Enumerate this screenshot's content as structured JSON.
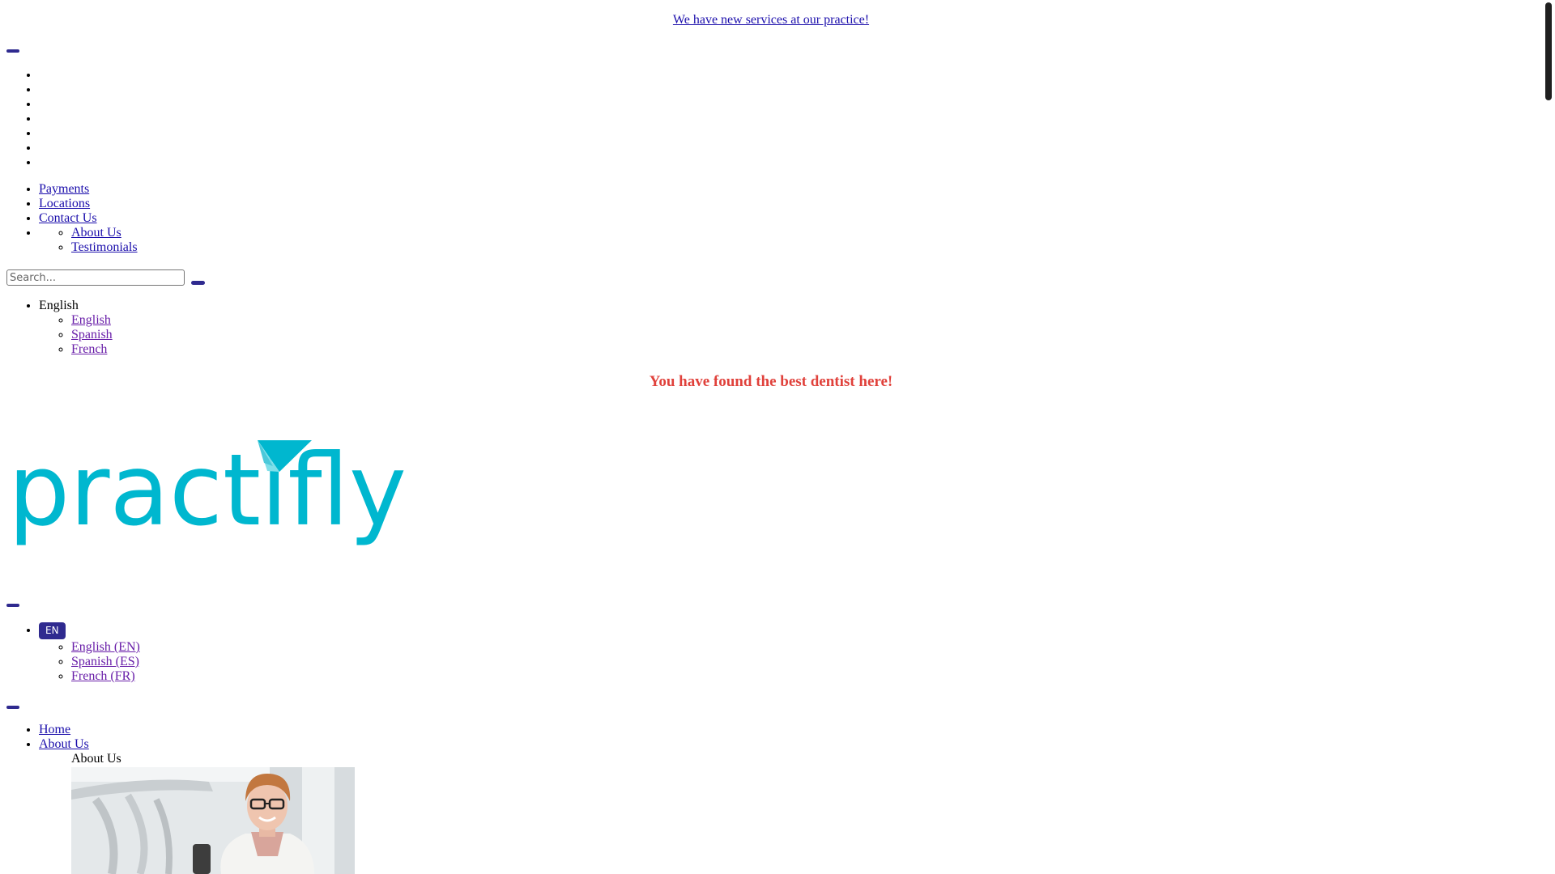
{
  "announcement": {
    "text": "We have new services at our practice! "
  },
  "nav_primary": {
    "empty_items": [
      "",
      "",
      "",
      "",
      "",
      "",
      ""
    ],
    "links": [
      {
        "label": "Payments"
      },
      {
        "label": "Locations"
      },
      {
        "label": "Contact Us"
      }
    ],
    "about_submenu": [
      {
        "label": "About Us"
      },
      {
        "label": "Testimonials"
      }
    ]
  },
  "search": {
    "placeholder": "Search..."
  },
  "language_menu": {
    "current": "English",
    "options": [
      {
        "label": "English"
      },
      {
        "label": "Spanish"
      },
      {
        "label": "French"
      }
    ]
  },
  "tagline": "You have found the best dentist here!",
  "logo": {
    "text": "practifly",
    "color": "#00b7cf"
  },
  "language_menu_mobile": {
    "badge": "EN",
    "options": [
      {
        "label": "English (EN)"
      },
      {
        "label": "Spanish (ES)"
      },
      {
        "label": "French (FR)"
      }
    ]
  },
  "nav_main": {
    "links": [
      {
        "label": "Home"
      },
      {
        "label": "About Us"
      }
    ],
    "about_heading": "About Us"
  },
  "colors": {
    "link": "#1a0dab",
    "visited": "#681da8",
    "accent": "#2f2a8f",
    "tagline": "#e0413b",
    "brand": "#00b7cf"
  }
}
